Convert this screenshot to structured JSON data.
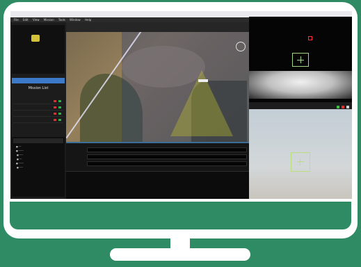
{
  "colors": {
    "background": "#2e8b63",
    "monitor": "#ffffff",
    "accent_blue": "#3c79c8",
    "osd_red": "#ff4040",
    "reticle_green": "#a4d48a"
  },
  "app": {
    "title": "",
    "menu": [
      "File",
      "Edit",
      "View",
      "Mission",
      "Tools",
      "Window",
      "Help"
    ],
    "mission_panel": {
      "title": "Mission List",
      "rows": [
        {
          "status": [
            "red",
            "green"
          ]
        },
        {
          "status": [
            "red",
            "green"
          ]
        },
        {
          "status": [
            "red",
            "green"
          ]
        },
        {
          "status": [
            "red",
            "green"
          ]
        }
      ]
    }
  },
  "video": {
    "title": "",
    "status_colors": [
      "#3fbf3f",
      "#e03030",
      "#d0d0d0"
    ]
  },
  "icons": [
    "logo-icon",
    "compass-icon",
    "uav-icon",
    "crosshair-icon",
    "target-marker-icon"
  ]
}
